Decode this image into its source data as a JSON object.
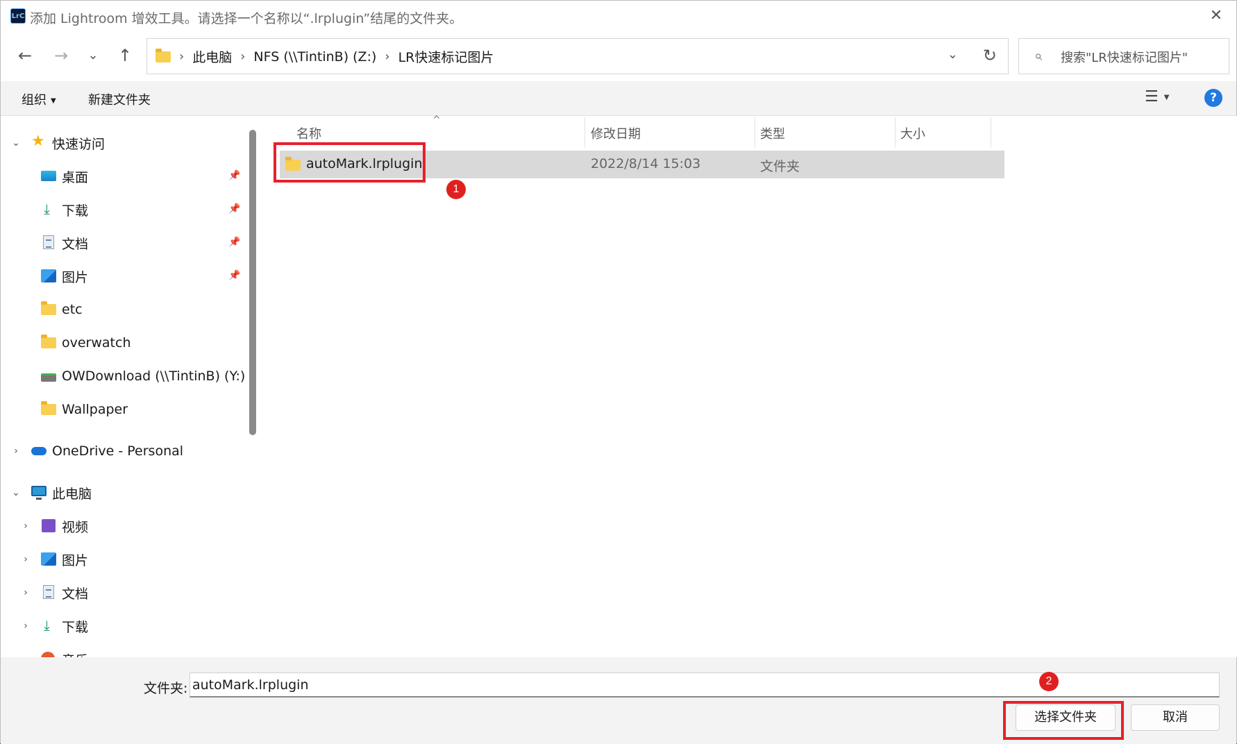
{
  "window": {
    "app_icon_text": "LrC",
    "title": "添加 Lightroom 增效工具。请选择一个名称以“.lrplugin”结尾的文件夹。",
    "close_glyph": "✕"
  },
  "nav": {
    "back_glyph": "←",
    "forward_glyph": "→",
    "recent_glyph": "⌄",
    "up_glyph": "↑",
    "breadcrumbs": [
      "此电脑",
      "NFS (\\\\TintinB) (Z:)",
      "LR快速标记图片"
    ],
    "separator": "›",
    "dropdown_glyph": "⌄",
    "refresh_glyph": "↻",
    "search_placeholder": "搜索\"LR快速标记图片\"",
    "search_glyph": "⌕"
  },
  "toolbar": {
    "organize_label": "组织",
    "new_folder_label": "新建文件夹",
    "view_glyph": "☰",
    "help_glyph": "?"
  },
  "sidebar": {
    "quick_access": "快速访问",
    "items": [
      {
        "label": "桌面",
        "icon": "desktop-icon",
        "pinned": true
      },
      {
        "label": "下载",
        "icon": "download-icon",
        "pinned": true
      },
      {
        "label": "文档",
        "icon": "documents-icon",
        "pinned": true
      },
      {
        "label": "图片",
        "icon": "pictures-icon",
        "pinned": true
      },
      {
        "label": "etc",
        "icon": "folder-icon",
        "pinned": false
      },
      {
        "label": "overwatch",
        "icon": "folder-icon",
        "pinned": false
      },
      {
        "label": "OWDownload (\\\\TintinB) (Y:)",
        "icon": "network-drive-icon",
        "pinned": false
      },
      {
        "label": "Wallpaper",
        "icon": "folder-icon",
        "pinned": false
      }
    ],
    "onedrive": "OneDrive - Personal",
    "this_pc": "此电脑",
    "pc_items": [
      {
        "label": "视频",
        "icon": "videos-icon"
      },
      {
        "label": "图片",
        "icon": "pictures-icon"
      },
      {
        "label": "文档",
        "icon": "documents-icon"
      },
      {
        "label": "下载",
        "icon": "download-icon"
      },
      {
        "label": "音乐",
        "icon": "music-icon"
      }
    ],
    "pin_glyph": "📌",
    "expanded_glyph": "⌄",
    "collapsed_glyph": "›"
  },
  "list": {
    "sort_glyph": "^",
    "columns": {
      "name": "名称",
      "modified": "修改日期",
      "type": "类型",
      "size": "大小"
    },
    "rows": [
      {
        "name": "autoMark.lrplugin",
        "modified": "2022/8/14 15:03",
        "type": "文件夹",
        "size": ""
      }
    ]
  },
  "annotations": {
    "badge_1": "1",
    "badge_2": "2",
    "color": "#e8202a"
  },
  "bottom": {
    "folder_label": "文件夹:",
    "folder_value": "autoMark.lrplugin",
    "select_button": "选择文件夹",
    "cancel_button": "取消"
  }
}
